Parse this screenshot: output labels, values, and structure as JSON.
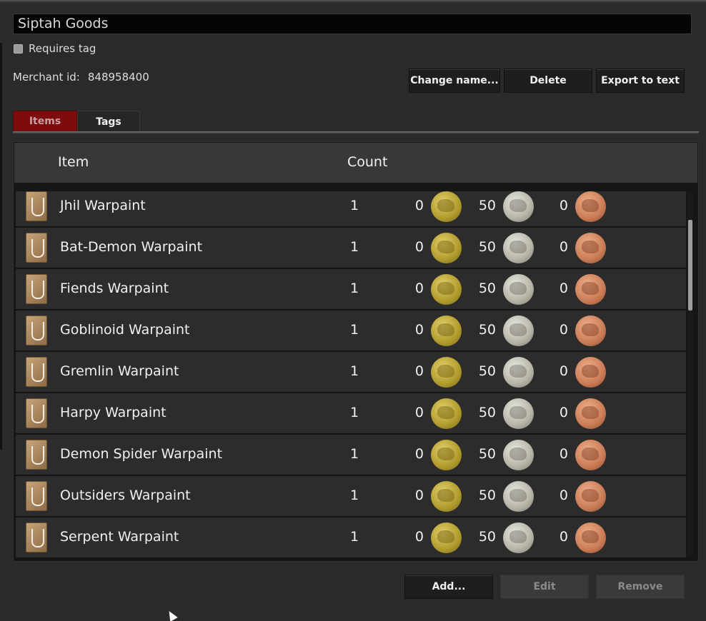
{
  "merchant": {
    "name": "Siptah Goods",
    "requires_tag_label": "Requires tag",
    "requires_tag_checked": false,
    "merchant_id_label": "Merchant id:",
    "merchant_id_value": "848958400"
  },
  "actions": {
    "change_name": "Change name...",
    "delete": "Delete",
    "export": "Export to text"
  },
  "tabs": {
    "items": "Items",
    "tags": "Tags",
    "active": "Items"
  },
  "table": {
    "headers": {
      "item": "Item",
      "count": "Count"
    },
    "rows": [
      {
        "name": "Jhil Warpaint",
        "count": "1",
        "gold": "0",
        "silver": "50",
        "copper": "0"
      },
      {
        "name": "Bat-Demon Warpaint",
        "count": "1",
        "gold": "0",
        "silver": "50",
        "copper": "0"
      },
      {
        "name": "Fiends Warpaint",
        "count": "1",
        "gold": "0",
        "silver": "50",
        "copper": "0"
      },
      {
        "name": "Goblinoid Warpaint",
        "count": "1",
        "gold": "0",
        "silver": "50",
        "copper": "0"
      },
      {
        "name": "Gremlin Warpaint",
        "count": "1",
        "gold": "0",
        "silver": "50",
        "copper": "0"
      },
      {
        "name": "Harpy Warpaint",
        "count": "1",
        "gold": "0",
        "silver": "50",
        "copper": "0"
      },
      {
        "name": "Demon Spider Warpaint",
        "count": "1",
        "gold": "0",
        "silver": "50",
        "copper": "0"
      },
      {
        "name": "Outsiders Warpaint",
        "count": "1",
        "gold": "0",
        "silver": "50",
        "copper": "0"
      },
      {
        "name": "Serpent Warpaint",
        "count": "1",
        "gold": "0",
        "silver": "50",
        "copper": "0"
      }
    ]
  },
  "footer": {
    "add": "Add...",
    "edit": "Edit",
    "remove": "Remove"
  },
  "colors": {
    "accent_tab": "#7d0c0c",
    "background": "#2a2a2a"
  }
}
